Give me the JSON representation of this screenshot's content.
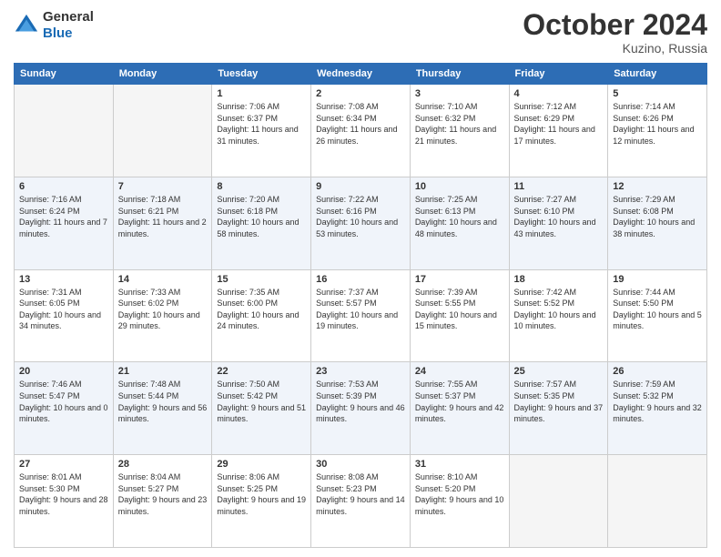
{
  "header": {
    "logo_line1": "General",
    "logo_line2": "Blue",
    "month": "October 2024",
    "location": "Kuzino, Russia"
  },
  "days_of_week": [
    "Sunday",
    "Monday",
    "Tuesday",
    "Wednesday",
    "Thursday",
    "Friday",
    "Saturday"
  ],
  "weeks": [
    [
      {
        "day": "",
        "sunrise": "",
        "sunset": "",
        "daylight": "",
        "empty": true
      },
      {
        "day": "",
        "sunrise": "",
        "sunset": "",
        "daylight": "",
        "empty": true
      },
      {
        "day": "1",
        "sunrise": "Sunrise: 7:06 AM",
        "sunset": "Sunset: 6:37 PM",
        "daylight": "Daylight: 11 hours and 31 minutes.",
        "empty": false
      },
      {
        "day": "2",
        "sunrise": "Sunrise: 7:08 AM",
        "sunset": "Sunset: 6:34 PM",
        "daylight": "Daylight: 11 hours and 26 minutes.",
        "empty": false
      },
      {
        "day": "3",
        "sunrise": "Sunrise: 7:10 AM",
        "sunset": "Sunset: 6:32 PM",
        "daylight": "Daylight: 11 hours and 21 minutes.",
        "empty": false
      },
      {
        "day": "4",
        "sunrise": "Sunrise: 7:12 AM",
        "sunset": "Sunset: 6:29 PM",
        "daylight": "Daylight: 11 hours and 17 minutes.",
        "empty": false
      },
      {
        "day": "5",
        "sunrise": "Sunrise: 7:14 AM",
        "sunset": "Sunset: 6:26 PM",
        "daylight": "Daylight: 11 hours and 12 minutes.",
        "empty": false
      }
    ],
    [
      {
        "day": "6",
        "sunrise": "Sunrise: 7:16 AM",
        "sunset": "Sunset: 6:24 PM",
        "daylight": "Daylight: 11 hours and 7 minutes.",
        "empty": false
      },
      {
        "day": "7",
        "sunrise": "Sunrise: 7:18 AM",
        "sunset": "Sunset: 6:21 PM",
        "daylight": "Daylight: 11 hours and 2 minutes.",
        "empty": false
      },
      {
        "day": "8",
        "sunrise": "Sunrise: 7:20 AM",
        "sunset": "Sunset: 6:18 PM",
        "daylight": "Daylight: 10 hours and 58 minutes.",
        "empty": false
      },
      {
        "day": "9",
        "sunrise": "Sunrise: 7:22 AM",
        "sunset": "Sunset: 6:16 PM",
        "daylight": "Daylight: 10 hours and 53 minutes.",
        "empty": false
      },
      {
        "day": "10",
        "sunrise": "Sunrise: 7:25 AM",
        "sunset": "Sunset: 6:13 PM",
        "daylight": "Daylight: 10 hours and 48 minutes.",
        "empty": false
      },
      {
        "day": "11",
        "sunrise": "Sunrise: 7:27 AM",
        "sunset": "Sunset: 6:10 PM",
        "daylight": "Daylight: 10 hours and 43 minutes.",
        "empty": false
      },
      {
        "day": "12",
        "sunrise": "Sunrise: 7:29 AM",
        "sunset": "Sunset: 6:08 PM",
        "daylight": "Daylight: 10 hours and 38 minutes.",
        "empty": false
      }
    ],
    [
      {
        "day": "13",
        "sunrise": "Sunrise: 7:31 AM",
        "sunset": "Sunset: 6:05 PM",
        "daylight": "Daylight: 10 hours and 34 minutes.",
        "empty": false
      },
      {
        "day": "14",
        "sunrise": "Sunrise: 7:33 AM",
        "sunset": "Sunset: 6:02 PM",
        "daylight": "Daylight: 10 hours and 29 minutes.",
        "empty": false
      },
      {
        "day": "15",
        "sunrise": "Sunrise: 7:35 AM",
        "sunset": "Sunset: 6:00 PM",
        "daylight": "Daylight: 10 hours and 24 minutes.",
        "empty": false
      },
      {
        "day": "16",
        "sunrise": "Sunrise: 7:37 AM",
        "sunset": "Sunset: 5:57 PM",
        "daylight": "Daylight: 10 hours and 19 minutes.",
        "empty": false
      },
      {
        "day": "17",
        "sunrise": "Sunrise: 7:39 AM",
        "sunset": "Sunset: 5:55 PM",
        "daylight": "Daylight: 10 hours and 15 minutes.",
        "empty": false
      },
      {
        "day": "18",
        "sunrise": "Sunrise: 7:42 AM",
        "sunset": "Sunset: 5:52 PM",
        "daylight": "Daylight: 10 hours and 10 minutes.",
        "empty": false
      },
      {
        "day": "19",
        "sunrise": "Sunrise: 7:44 AM",
        "sunset": "Sunset: 5:50 PM",
        "daylight": "Daylight: 10 hours and 5 minutes.",
        "empty": false
      }
    ],
    [
      {
        "day": "20",
        "sunrise": "Sunrise: 7:46 AM",
        "sunset": "Sunset: 5:47 PM",
        "daylight": "Daylight: 10 hours and 0 minutes.",
        "empty": false
      },
      {
        "day": "21",
        "sunrise": "Sunrise: 7:48 AM",
        "sunset": "Sunset: 5:44 PM",
        "daylight": "Daylight: 9 hours and 56 minutes.",
        "empty": false
      },
      {
        "day": "22",
        "sunrise": "Sunrise: 7:50 AM",
        "sunset": "Sunset: 5:42 PM",
        "daylight": "Daylight: 9 hours and 51 minutes.",
        "empty": false
      },
      {
        "day": "23",
        "sunrise": "Sunrise: 7:53 AM",
        "sunset": "Sunset: 5:39 PM",
        "daylight": "Daylight: 9 hours and 46 minutes.",
        "empty": false
      },
      {
        "day": "24",
        "sunrise": "Sunrise: 7:55 AM",
        "sunset": "Sunset: 5:37 PM",
        "daylight": "Daylight: 9 hours and 42 minutes.",
        "empty": false
      },
      {
        "day": "25",
        "sunrise": "Sunrise: 7:57 AM",
        "sunset": "Sunset: 5:35 PM",
        "daylight": "Daylight: 9 hours and 37 minutes.",
        "empty": false
      },
      {
        "day": "26",
        "sunrise": "Sunrise: 7:59 AM",
        "sunset": "Sunset: 5:32 PM",
        "daylight": "Daylight: 9 hours and 32 minutes.",
        "empty": false
      }
    ],
    [
      {
        "day": "27",
        "sunrise": "Sunrise: 8:01 AM",
        "sunset": "Sunset: 5:30 PM",
        "daylight": "Daylight: 9 hours and 28 minutes.",
        "empty": false
      },
      {
        "day": "28",
        "sunrise": "Sunrise: 8:04 AM",
        "sunset": "Sunset: 5:27 PM",
        "daylight": "Daylight: 9 hours and 23 minutes.",
        "empty": false
      },
      {
        "day": "29",
        "sunrise": "Sunrise: 8:06 AM",
        "sunset": "Sunset: 5:25 PM",
        "daylight": "Daylight: 9 hours and 19 minutes.",
        "empty": false
      },
      {
        "day": "30",
        "sunrise": "Sunrise: 8:08 AM",
        "sunset": "Sunset: 5:23 PM",
        "daylight": "Daylight: 9 hours and 14 minutes.",
        "empty": false
      },
      {
        "day": "31",
        "sunrise": "Sunrise: 8:10 AM",
        "sunset": "Sunset: 5:20 PM",
        "daylight": "Daylight: 9 hours and 10 minutes.",
        "empty": false
      },
      {
        "day": "",
        "sunrise": "",
        "sunset": "",
        "daylight": "",
        "empty": true
      },
      {
        "day": "",
        "sunrise": "",
        "sunset": "",
        "daylight": "",
        "empty": true
      }
    ]
  ]
}
